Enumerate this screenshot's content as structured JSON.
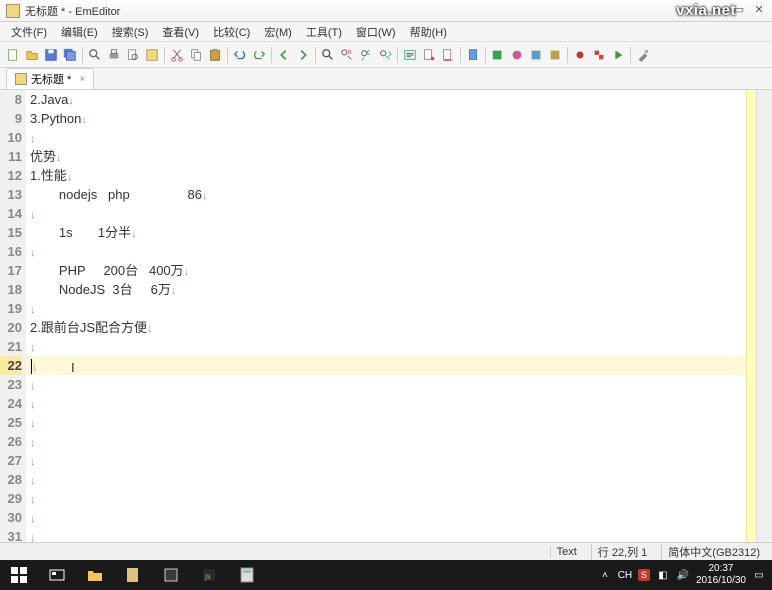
{
  "window": {
    "title": "无标题 * - EmEditor",
    "watermark": "vxia.net"
  },
  "menu": [
    "文件(F)",
    "编辑(E)",
    "搜索(S)",
    "查看(V)",
    "比较(C)",
    "宏(M)",
    "工具(T)",
    "窗口(W)",
    "帮助(H)"
  ],
  "tab": {
    "label": "无标题 *"
  },
  "lines": [
    {
      "n": 8,
      "t": "2.Java"
    },
    {
      "n": 9,
      "t": "3.Python"
    },
    {
      "n": 10,
      "t": ""
    },
    {
      "n": 11,
      "t": "优势"
    },
    {
      "n": 12,
      "t": "1.性能"
    },
    {
      "n": 13,
      "t": "        nodejs   php                86"
    },
    {
      "n": 14,
      "t": ""
    },
    {
      "n": 15,
      "t": "        1s       1分半"
    },
    {
      "n": 16,
      "t": ""
    },
    {
      "n": 17,
      "t": "        PHP     200台   400万"
    },
    {
      "n": 18,
      "t": "        NodeJS  3台     6万"
    },
    {
      "n": 19,
      "t": ""
    },
    {
      "n": 20,
      "t": "2.跟前台JS配合方便"
    },
    {
      "n": 21,
      "t": ""
    },
    {
      "n": 22,
      "t": "",
      "cursor": true
    },
    {
      "n": 23,
      "t": ""
    },
    {
      "n": 24,
      "t": ""
    },
    {
      "n": 25,
      "t": ""
    },
    {
      "n": 26,
      "t": ""
    },
    {
      "n": 27,
      "t": ""
    },
    {
      "n": 28,
      "t": ""
    },
    {
      "n": 29,
      "t": ""
    },
    {
      "n": 30,
      "t": ""
    },
    {
      "n": 31,
      "t": ""
    }
  ],
  "status": {
    "mode": "Text",
    "pos": "行 22,列 1",
    "encoding": "简体中文(GB2312)"
  },
  "tray": {
    "ime1": "CH",
    "ime2": "S",
    "time": "20:37",
    "date": "2016/10/30"
  }
}
